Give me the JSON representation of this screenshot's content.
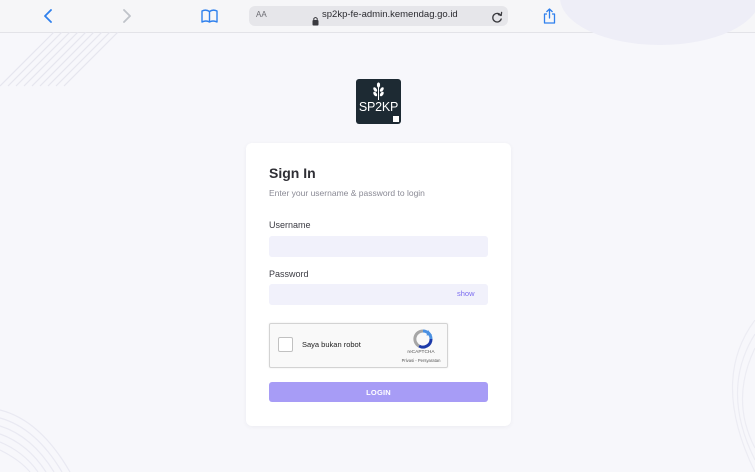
{
  "browser": {
    "url": "sp2kp-fe-admin.kemendag.go.id",
    "text_size_label": "AA",
    "accent_color": "#2f80ed",
    "icons": [
      "back-icon",
      "forward-icon",
      "bookmarks-icon",
      "lock-icon",
      "reload-icon",
      "share-icon",
      "new-tab-icon",
      "tabs-icon"
    ]
  },
  "logo": {
    "text": "SP2KP"
  },
  "sign_in": {
    "title": "Sign In",
    "subtitle": "Enter your username & password to login",
    "username_label": "Username",
    "username_value": "",
    "password_label": "Password",
    "password_value": "",
    "show_label": "show",
    "login_label": "LOGIN",
    "button_color": "#a79cf6",
    "link_color": "#7b6cf0"
  },
  "captcha": {
    "label": "Saya bukan robot",
    "brand": "reCAPTCHA",
    "links": "Privasi - Persyaratan",
    "checked": false
  }
}
